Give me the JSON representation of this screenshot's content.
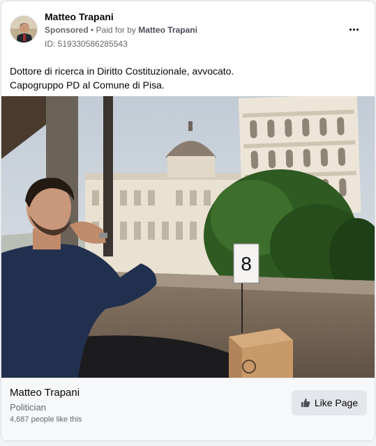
{
  "post": {
    "author": "Matteo Trapani",
    "sponsored_label": "Sponsored",
    "separator": " • ",
    "paid_for_prefix": "Paid for by ",
    "paid_for_name": "Matteo Trapani",
    "ad_id": "ID: 519330586285543",
    "body_lines": [
      "Dottore di ricerca in Diritto Costituzionale, avvocato.",
      "Capogruppo PD al Comune di Pisa."
    ],
    "table_number": "8"
  },
  "page_card": {
    "name": "Matteo Trapani",
    "category": "Politician",
    "likes": "4,687 people like this",
    "like_button_label": "Like Page"
  },
  "icons": {
    "more": "more-options-icon",
    "like": "thumbs-up-icon"
  },
  "colors": {
    "secondary_text": "#65676b",
    "button_bg": "#e4e6eb",
    "footer_bg": "#f7f8fa"
  }
}
